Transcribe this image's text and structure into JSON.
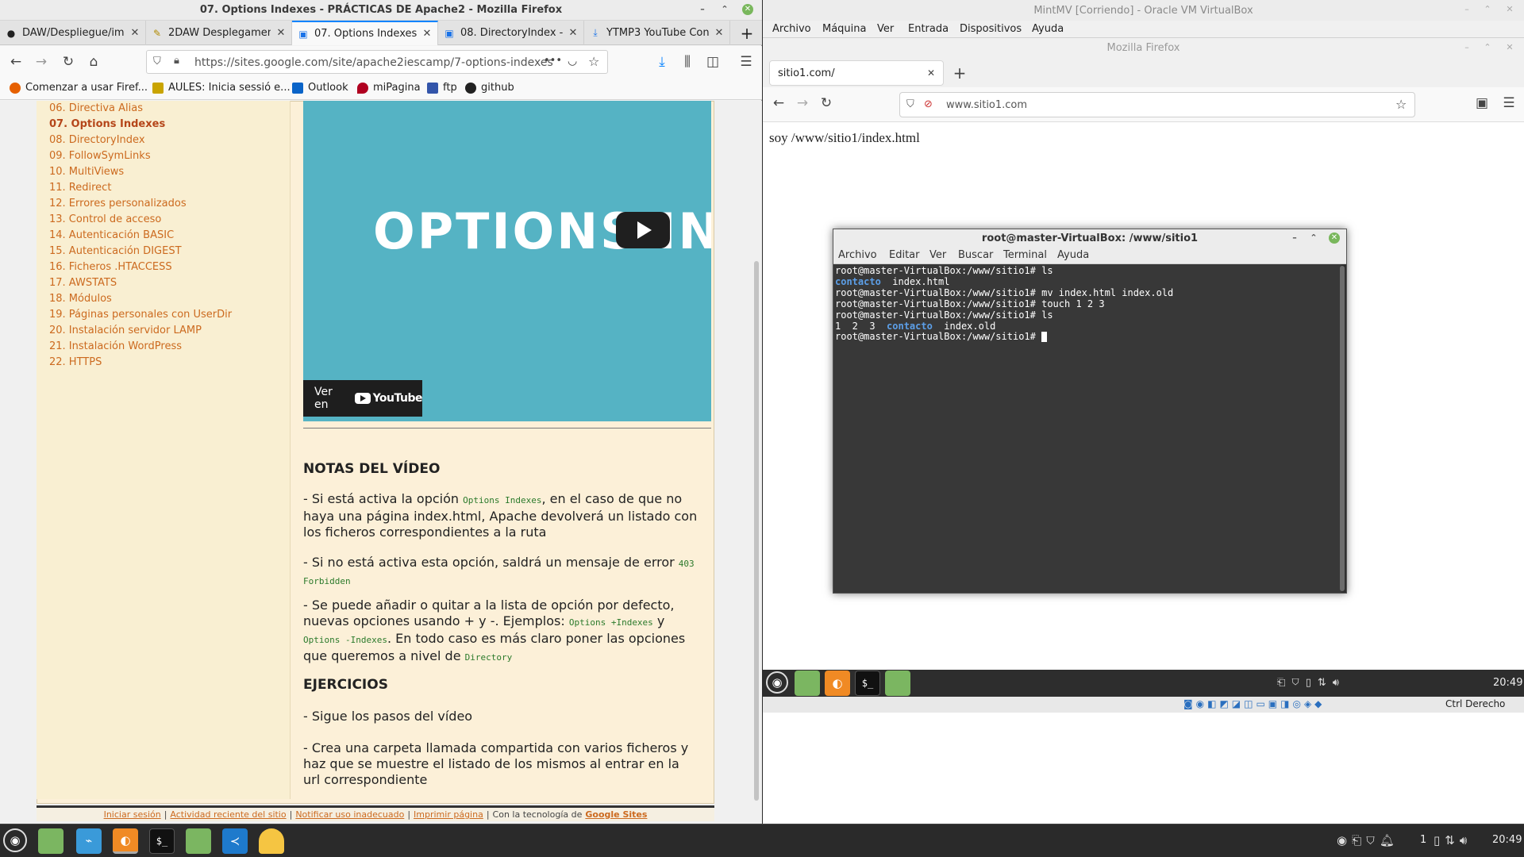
{
  "host_firefox": {
    "window_title": "07. Options Indexes - PRÁCTICAS DE Apache2 - Mozilla Firefox",
    "tabs": [
      {
        "label": "DAW/Despliegue/im",
        "icon": "github-icon"
      },
      {
        "label": "2DAW Desplegamen",
        "icon": "document-icon"
      },
      {
        "label": "07. Options Indexes",
        "icon": "sites-icon",
        "active": true
      },
      {
        "label": "08. DirectoryIndex -",
        "icon": "sites-icon"
      },
      {
        "label": "YTMP3 YouTube Con",
        "icon": "download-icon"
      }
    ],
    "new_tab_label": "+",
    "url": "https://sites.google.com/site/apache2iescamp/7-options-indexes",
    "url_more": "•••",
    "bookmarks": [
      {
        "label": "Comenzar a usar Firef...",
        "color": "#e66000"
      },
      {
        "label": "AULES: Inicia sessió e...",
        "color": "#b08a00"
      },
      {
        "label": "Outlook",
        "color": "#0a64c8"
      },
      {
        "label": "miPagina",
        "color": "#b00020"
      },
      {
        "label": "ftp",
        "color": "#3355aa"
      },
      {
        "label": "github",
        "color": "#222222"
      }
    ],
    "sidebar_items": [
      "06. Directiva Alias",
      "07. Options Indexes",
      "08. DirectoryIndex",
      "09. FollowSymLinks",
      "10. MultiViews",
      "11. Redirect",
      "12. Errores personalizados",
      "13. Control de acceso",
      "14. Autenticación BASIC",
      "15. Autenticación DIGEST",
      "16. Ficheros .HTACCESS",
      "17. AWSTATS",
      "18. Módulos",
      "19. Páginas personales con UserDir",
      "20. Instalación servidor LAMP",
      "21. Instalación WordPress",
      "22. HTTPS"
    ],
    "video": {
      "overlay_text": "OPTIONS IN",
      "watch_on": "Ver en",
      "youtube": "YouTube"
    },
    "article": {
      "notes_heading": "NOTAS DEL VÍDEO",
      "p1_a": "- Si está activa la opción ",
      "p1_code": "Options Indexes",
      "p1_b": ", en el caso de que no haya una página index.html, Apache devolverá un listado con los  ficheros correspondientes a la ruta",
      "p2_a": "- Si no está activa esta opción, saldrá un mensaje de error ",
      "p2_code": "403 Forbidden",
      "p3_a": "- Se puede añadir o quitar a la lista de opción por defecto, nuevas opciones usando + y -. Ejemplos: ",
      "p3_code1": "Options +Indexes",
      "p3_b": " y ",
      "p3_code2": "Options -Indexes",
      "p3_c": ". En todo caso es más claro poner las opciones que queremos a nivel de ",
      "p3_code3": "Directory",
      "exercises_heading": "EJERCICIOS",
      "e1": "- Sigue los pasos del vídeo",
      "e2": "- Crea una carpeta llamada compartida con varios ficheros y haz que se muestre el listado de los mismos al entrar en la url correspondiente"
    },
    "footer": {
      "signin": "Iniciar sesión",
      "recent": "Actividad reciente del sitio",
      "report": "Notificar uso inadecuado",
      "print": "Imprimir página",
      "powered": "Con la tecnología de",
      "gsites": "Google Sites",
      "sep": "|"
    }
  },
  "virtualbox": {
    "window_title": "MintMV [Corriendo] - Oracle VM VirtualBox",
    "menu": [
      "Archivo",
      "Máquina",
      "Ver",
      "Entrada",
      "Dispositivos",
      "Ayuda"
    ],
    "guest_firefox": {
      "window_title": "Mozilla Firefox",
      "tab_label": "sitio1.com/",
      "new_tab_label": "+",
      "url": "www.sitio1.com",
      "page_text": "soy /www/sitio1/index.html"
    },
    "terminal": {
      "title": "root@master-VirtualBox: /www/sitio1",
      "menu": [
        "Archivo",
        "Editar",
        "Ver",
        "Buscar",
        "Terminal",
        "Ayuda"
      ],
      "prompt": "root@master-VirtualBox:/www/sitio1# ",
      "lines": [
        {
          "cmd": "ls"
        },
        {
          "out_blue": "contacto",
          "out": "  index.html"
        },
        {
          "cmd": "mv index.html index.old"
        },
        {
          "cmd": "touch 1 2 3"
        },
        {
          "cmd": "ls"
        },
        {
          "out_pre": "1  2  3  ",
          "out_blue": "contacto",
          "out": "  index.old"
        }
      ]
    },
    "guest_clock": "20:49",
    "host_key": "Ctrl Derecho"
  },
  "host_taskbar": {
    "workspace": "1",
    "clock": "20:49"
  }
}
